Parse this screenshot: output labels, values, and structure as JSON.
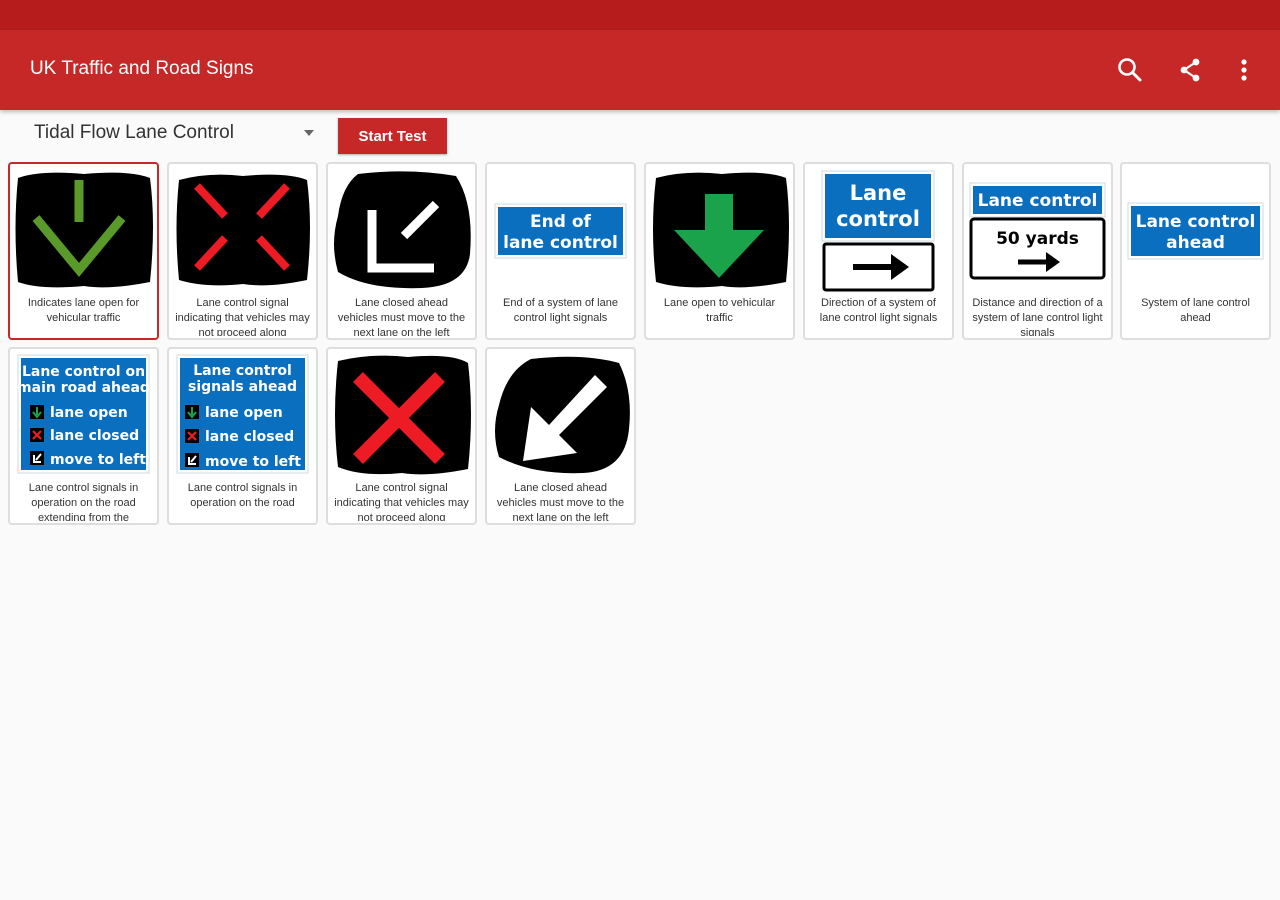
{
  "app_bar": {
    "title": "UK Traffic and Road Signs",
    "actions": [
      "search-icon",
      "share-icon",
      "more-vert-icon"
    ]
  },
  "filter": {
    "selected_category": "Tidal Flow Lane Control",
    "start_test_label": "Start Test"
  },
  "colors": {
    "primary": "#c62828",
    "status_bar": "#b71c1c",
    "sign_blue": "#0b6fbf",
    "signal_green": "#1aa34a",
    "signal_red": "#ed1c24"
  },
  "signs": [
    {
      "caption": "Indicates lane open for vehicular traffic",
      "selected": true,
      "sign_text": []
    },
    {
      "caption": "Lane control signal indicating that vehicles may not proceed along",
      "selected": false,
      "sign_text": []
    },
    {
      "caption": "Lane closed ahead vehicles must move to the next lane on the left",
      "selected": false,
      "sign_text": []
    },
    {
      "caption": "End of a system of lane control light signals",
      "selected": false,
      "sign_text": [
        "End of",
        "lane control"
      ]
    },
    {
      "caption": "Lane open to vehicular traffic",
      "selected": false,
      "sign_text": []
    },
    {
      "caption": "Direction of a system of lane control light signals",
      "selected": false,
      "sign_text": [
        "Lane",
        "control"
      ]
    },
    {
      "caption": "Distance and direction of a system of lane control light signals",
      "selected": false,
      "sign_text": [
        "Lane control",
        "50 yards"
      ]
    },
    {
      "caption": "System of lane control ahead",
      "selected": false,
      "sign_text": [
        "Lane control",
        "ahead"
      ]
    },
    {
      "caption": "Lane control signals in operation on the road extending from the",
      "selected": false,
      "sign_text": [
        "Lane control on",
        "main road ahead",
        "lane open",
        "lane closed",
        "move to left"
      ]
    },
    {
      "caption": "Lane control signals in operation on the road",
      "selected": false,
      "sign_text": [
        "Lane control",
        "signals ahead",
        "lane open",
        "lane closed",
        "move to left"
      ]
    },
    {
      "caption": "Lane control signal indicating that vehicles may not proceed along",
      "selected": false,
      "sign_text": []
    },
    {
      "caption": "Lane closed ahead vehicles must move to the next lane on the left",
      "selected": false,
      "sign_text": []
    }
  ]
}
